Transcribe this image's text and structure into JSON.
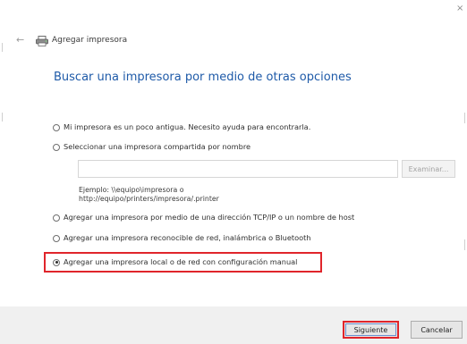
{
  "window": {
    "close_glyph": "×",
    "back_glyph": "←",
    "title": "Agregar impresora",
    "title_icon": "printer-icon"
  },
  "page_title": "Buscar una impresora por medio de otras opciones",
  "options": [
    {
      "label": "Mi impresora es un poco antigua. Necesito ayuda para encontrarla.",
      "selected": false
    },
    {
      "label": "Seleccionar una impresora compartida por nombre",
      "selected": false
    },
    {
      "label": "Agregar una impresora por medio de una dirección TCP/IP o un nombre de host",
      "selected": false
    },
    {
      "label": "Agregar una impresora reconocible de red, inalámbrica o Bluetooth",
      "selected": false
    },
    {
      "label": "Agregar una impresora local o de red con configuración manual",
      "selected": true
    }
  ],
  "shared_printer": {
    "value": "",
    "browse_label": "Examinar...",
    "example_line1": "Ejemplo: \\\\equipo\\impresora o",
    "example_line2": "http://equipo/printers/impresora/.printer"
  },
  "footer": {
    "next_label": "Siguiente",
    "cancel_label": "Cancelar"
  },
  "colors": {
    "heading_blue": "#1e5aa8",
    "highlight_red": "#e0252b",
    "footer_bg": "#f0f0f0"
  }
}
